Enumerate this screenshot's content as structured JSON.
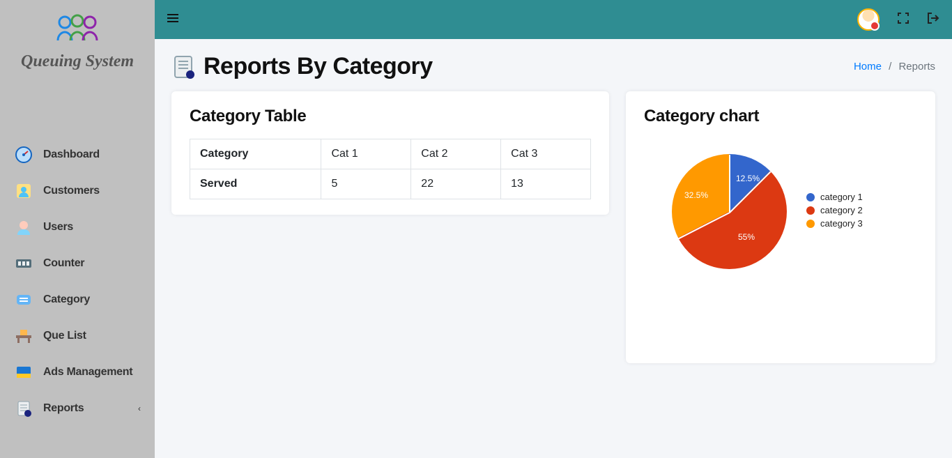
{
  "brand": {
    "name": "Queuing System"
  },
  "sidebar": {
    "items": [
      {
        "label": "Dashboard"
      },
      {
        "label": "Customers"
      },
      {
        "label": "Users"
      },
      {
        "label": "Counter"
      },
      {
        "label": "Category"
      },
      {
        "label": "Que List"
      },
      {
        "label": "Ads Management"
      },
      {
        "label": "Reports"
      }
    ]
  },
  "breadcrumb": {
    "home": "Home",
    "current": "Reports"
  },
  "page": {
    "title": "Reports By Category"
  },
  "table": {
    "title": "Category Table",
    "row1": {
      "h": "Category",
      "c1": "Cat 1",
      "c2": "Cat 2",
      "c3": "Cat 3"
    },
    "row2": {
      "h": "Served",
      "c1": "5",
      "c2": "22",
      "c3": "13"
    }
  },
  "chart": {
    "title": "Category chart",
    "legend": [
      {
        "label": "category 1",
        "color": "#3366cc"
      },
      {
        "label": "category 2",
        "color": "#dc3912"
      },
      {
        "label": "category 3",
        "color": "#ff9900"
      }
    ],
    "labels": {
      "p1": "12.5%",
      "p2": "55%",
      "p3": "32.5%"
    }
  },
  "chart_data": {
    "type": "pie",
    "title": "Category chart",
    "series": [
      {
        "name": "category 1",
        "value": 5,
        "percent": 12.5,
        "color": "#3366cc"
      },
      {
        "name": "category 2",
        "value": 22,
        "percent": 55.0,
        "color": "#dc3912"
      },
      {
        "name": "category 3",
        "value": 13,
        "percent": 32.5,
        "color": "#ff9900"
      }
    ]
  }
}
